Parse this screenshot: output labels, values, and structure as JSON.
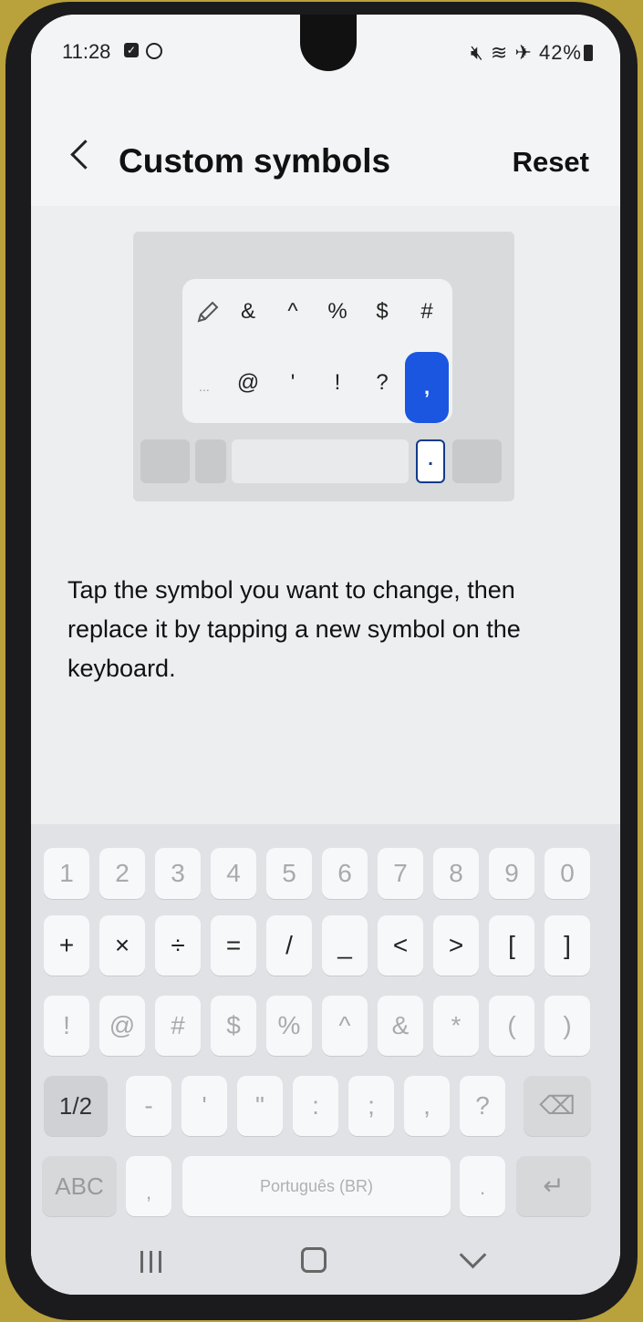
{
  "status": {
    "time": "11:28",
    "battery": "42%"
  },
  "header": {
    "title": "Custom symbols",
    "reset_label": "Reset"
  },
  "preview": {
    "row1": [
      "&",
      "^",
      "%",
      "$",
      "#"
    ],
    "row2": [
      "...",
      "@",
      "'",
      "!",
      "?"
    ],
    "selected": ",",
    "mini_period": "."
  },
  "instruction": "Tap the symbol you want to change, then replace it by tapping a new symbol on the keyboard.",
  "keyboard": {
    "row1": [
      "1",
      "2",
      "3",
      "4",
      "5",
      "6",
      "7",
      "8",
      "9",
      "0"
    ],
    "row2": [
      "+",
      "×",
      "÷",
      "=",
      "/",
      "_",
      "<",
      ">",
      "[",
      "]"
    ],
    "row3": [
      "!",
      "@",
      "#",
      "$",
      "%",
      "^",
      "&",
      "*",
      "(",
      ")"
    ],
    "row4": [
      "-",
      "'",
      "\"",
      ":",
      ";",
      ",",
      "?"
    ],
    "page_label": "1/2",
    "abc_label": "ABC",
    "comma": ",",
    "space_label": "Português (BR)",
    "period": "."
  },
  "icons": {
    "back": "chevron-left-icon",
    "edit": "pencil-icon",
    "delete": "backspace-icon",
    "enter": "enter-icon"
  },
  "colors": {
    "accent": "#1a56e0"
  }
}
